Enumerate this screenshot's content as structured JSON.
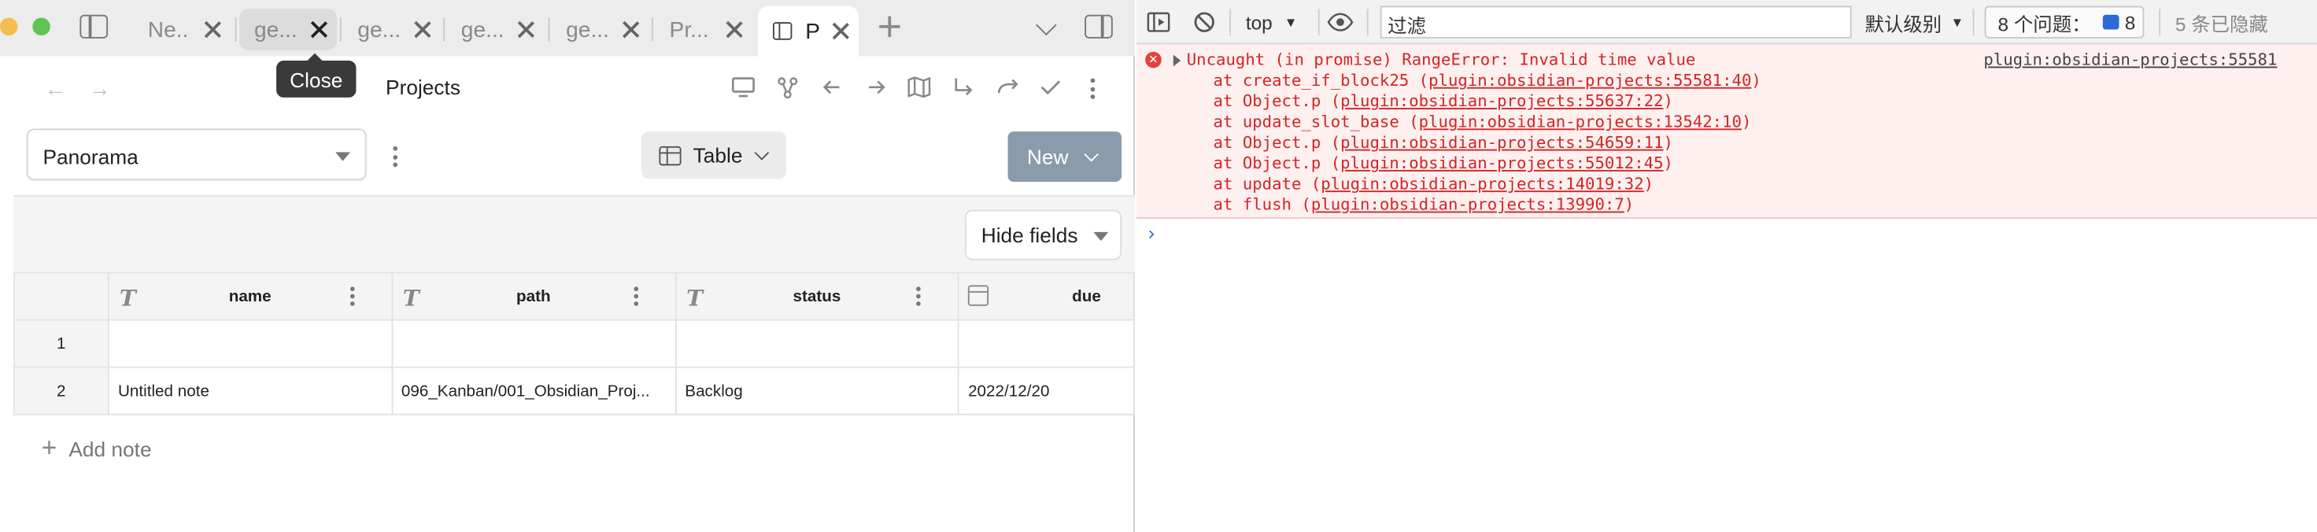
{
  "obsidian": {
    "tabs": [
      {
        "label": "Ne..."
      },
      {
        "label": "ge..."
      },
      {
        "label": "ge..."
      },
      {
        "label": "ge..."
      },
      {
        "label": "ge..."
      },
      {
        "label": "Pr..."
      },
      {
        "label": "P"
      }
    ],
    "tooltip": "Close",
    "view_title": "Projects",
    "project_select": "Panorama",
    "view_type": "Table",
    "new_button": "New",
    "hide_fields": "Hide fields",
    "columns": [
      {
        "label": "name",
        "icon": "text-type-icon"
      },
      {
        "label": "path",
        "icon": "text-type-icon"
      },
      {
        "label": "status",
        "icon": "text-type-icon"
      },
      {
        "label": "due",
        "icon": "calendar-icon"
      }
    ],
    "rows": [
      {
        "num": "1",
        "name": "",
        "path": "",
        "status": "",
        "due": ""
      },
      {
        "num": "2",
        "name": "Untitled note",
        "path": "096_Kanban/001_Obsidian_Proj...",
        "status": "Backlog",
        "due": "2022/12/20"
      }
    ],
    "add_note": "Add note"
  },
  "devtools": {
    "context": "top",
    "filter_placeholder": "过滤",
    "level": "默认级别",
    "issues_label": "8 个问题：",
    "issues_count": "8",
    "hidden_count": "5 条已隐藏",
    "error": {
      "message": "Uncaught (in promise) RangeError: Invalid time value",
      "source": "plugin:obsidian-projects:55581",
      "stack": [
        {
          "fn": "at create_if_block25 (",
          "loc": "plugin:obsidian-projects:55581:40",
          "end": ")"
        },
        {
          "fn": "at Object.p (",
          "loc": "plugin:obsidian-projects:55637:22",
          "end": ")"
        },
        {
          "fn": "at update_slot_base (",
          "loc": "plugin:obsidian-projects:13542:10",
          "end": ")"
        },
        {
          "fn": "at Object.p (",
          "loc": "plugin:obsidian-projects:54659:11",
          "end": ")"
        },
        {
          "fn": "at Object.p (",
          "loc": "plugin:obsidian-projects:55012:45",
          "end": ")"
        },
        {
          "fn": "at update (",
          "loc": "plugin:obsidian-projects:14019:32",
          "end": ")"
        },
        {
          "fn": "at flush (",
          "loc": "plugin:obsidian-projects:13990:7",
          "end": ")"
        }
      ]
    },
    "prompt": "›"
  }
}
